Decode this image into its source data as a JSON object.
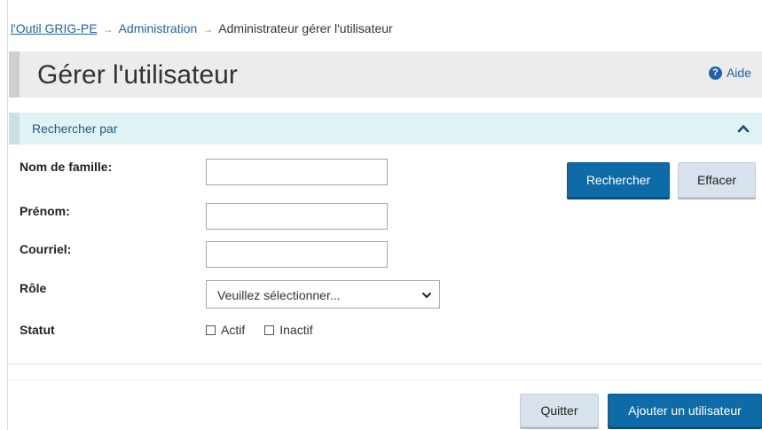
{
  "breadcrumb": {
    "home": "l'Outil GRIG-PE",
    "separator": "→",
    "admin": "Administration",
    "current": "Administrateur gérer l'utilisateur"
  },
  "page": {
    "title": "Gérer l'utilisateur",
    "help_label": "Aide",
    "help_icon": "question-circle-icon"
  },
  "search_panel": {
    "header": "Rechercher par",
    "collapse_icon": "chevron-up-icon",
    "fields": {
      "last_name_label": "Nom de famille:",
      "first_name_label": "Prénom:",
      "email_label": "Courriel:",
      "role_label": "Rôle",
      "status_label": "Statut"
    },
    "values": {
      "last_name": "",
      "first_name": "",
      "email": ""
    },
    "role_select": {
      "selected": "Veuillez sélectionner..."
    },
    "status_options": {
      "active": "Actif",
      "inactive": "Inactif"
    },
    "search_button": "Rechercher",
    "clear_button": "Effacer"
  },
  "footer": {
    "quit_button": "Quitter",
    "add_user_button": "Ajouter un utilisateur"
  },
  "colors": {
    "primary": "#0e6ba8",
    "link": "#1f62a8",
    "panel_header_bg": "#dff3f4",
    "title_bar_bg": "#ececec",
    "secondary_button": "#d8e2ec"
  }
}
